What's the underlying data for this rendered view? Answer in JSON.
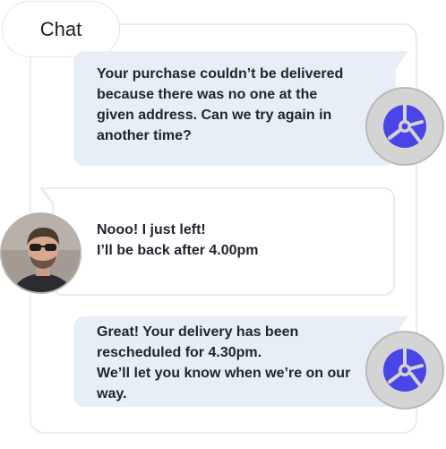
{
  "header": {
    "chat_tab_label": "Chat"
  },
  "messages": [
    {
      "sender": "bot",
      "lines": [
        "Your purchase couldn’t be delivered",
        "because there was no one at the",
        "given address. Can we try again in",
        "another time?"
      ]
    },
    {
      "sender": "user",
      "lines": [
        "Nooo! I just left!",
        "I’ll be back after 4.00pm"
      ]
    },
    {
      "sender": "bot",
      "lines": [
        "Great! Your delivery has been",
        "rescheduled for 4.30pm.",
        "We’ll let you know when we’re on our",
        "way."
      ]
    }
  ],
  "icons": {
    "bot_avatar": "chatbot-logo-icon",
    "user_avatar": "user-photo-avatar"
  },
  "colors": {
    "bot_bubble": "#e8eef5",
    "user_bubble_border": "#e6ecf3",
    "bot_logo": "#4a45e6",
    "bot_avatar_bg": "#d4d4d4",
    "text": "#1f2430"
  }
}
